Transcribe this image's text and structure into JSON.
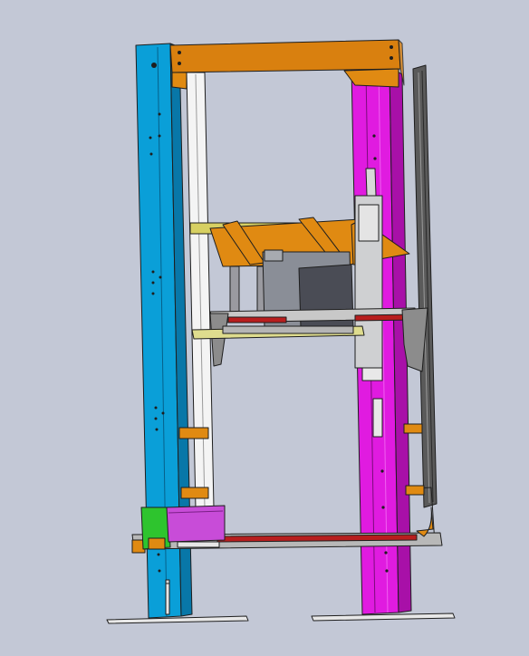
{
  "scene": {
    "kind": "cad-assembly-view",
    "background": "#c3c8d6",
    "colors": {
      "left_column": "#0a9fd8",
      "left_column_shade": "#0877a8",
      "right_column": "#e01be0",
      "right_column_shade": "#a810a8",
      "top_beam": "#d9800f",
      "bracket": "#e08a12",
      "inner_post": "#f4f4f4",
      "rail": "#5a5a5a",
      "carriage_box": "#8a8e97",
      "carriage_box_dark": "#4a4c55",
      "green_block": "#2ec42e",
      "purple_box": "#c84cd8",
      "red_strip": "#b81e1e",
      "base_plate": "#e8e8e8",
      "outline": "#1e1e1e"
    },
    "parts": [
      "left-column",
      "right-column",
      "top-beam",
      "inner-white-post",
      "right-vertical-rail",
      "carriage-platform",
      "lift-platform",
      "motor-box",
      "base-plates",
      "bottom-drive-unit"
    ]
  }
}
